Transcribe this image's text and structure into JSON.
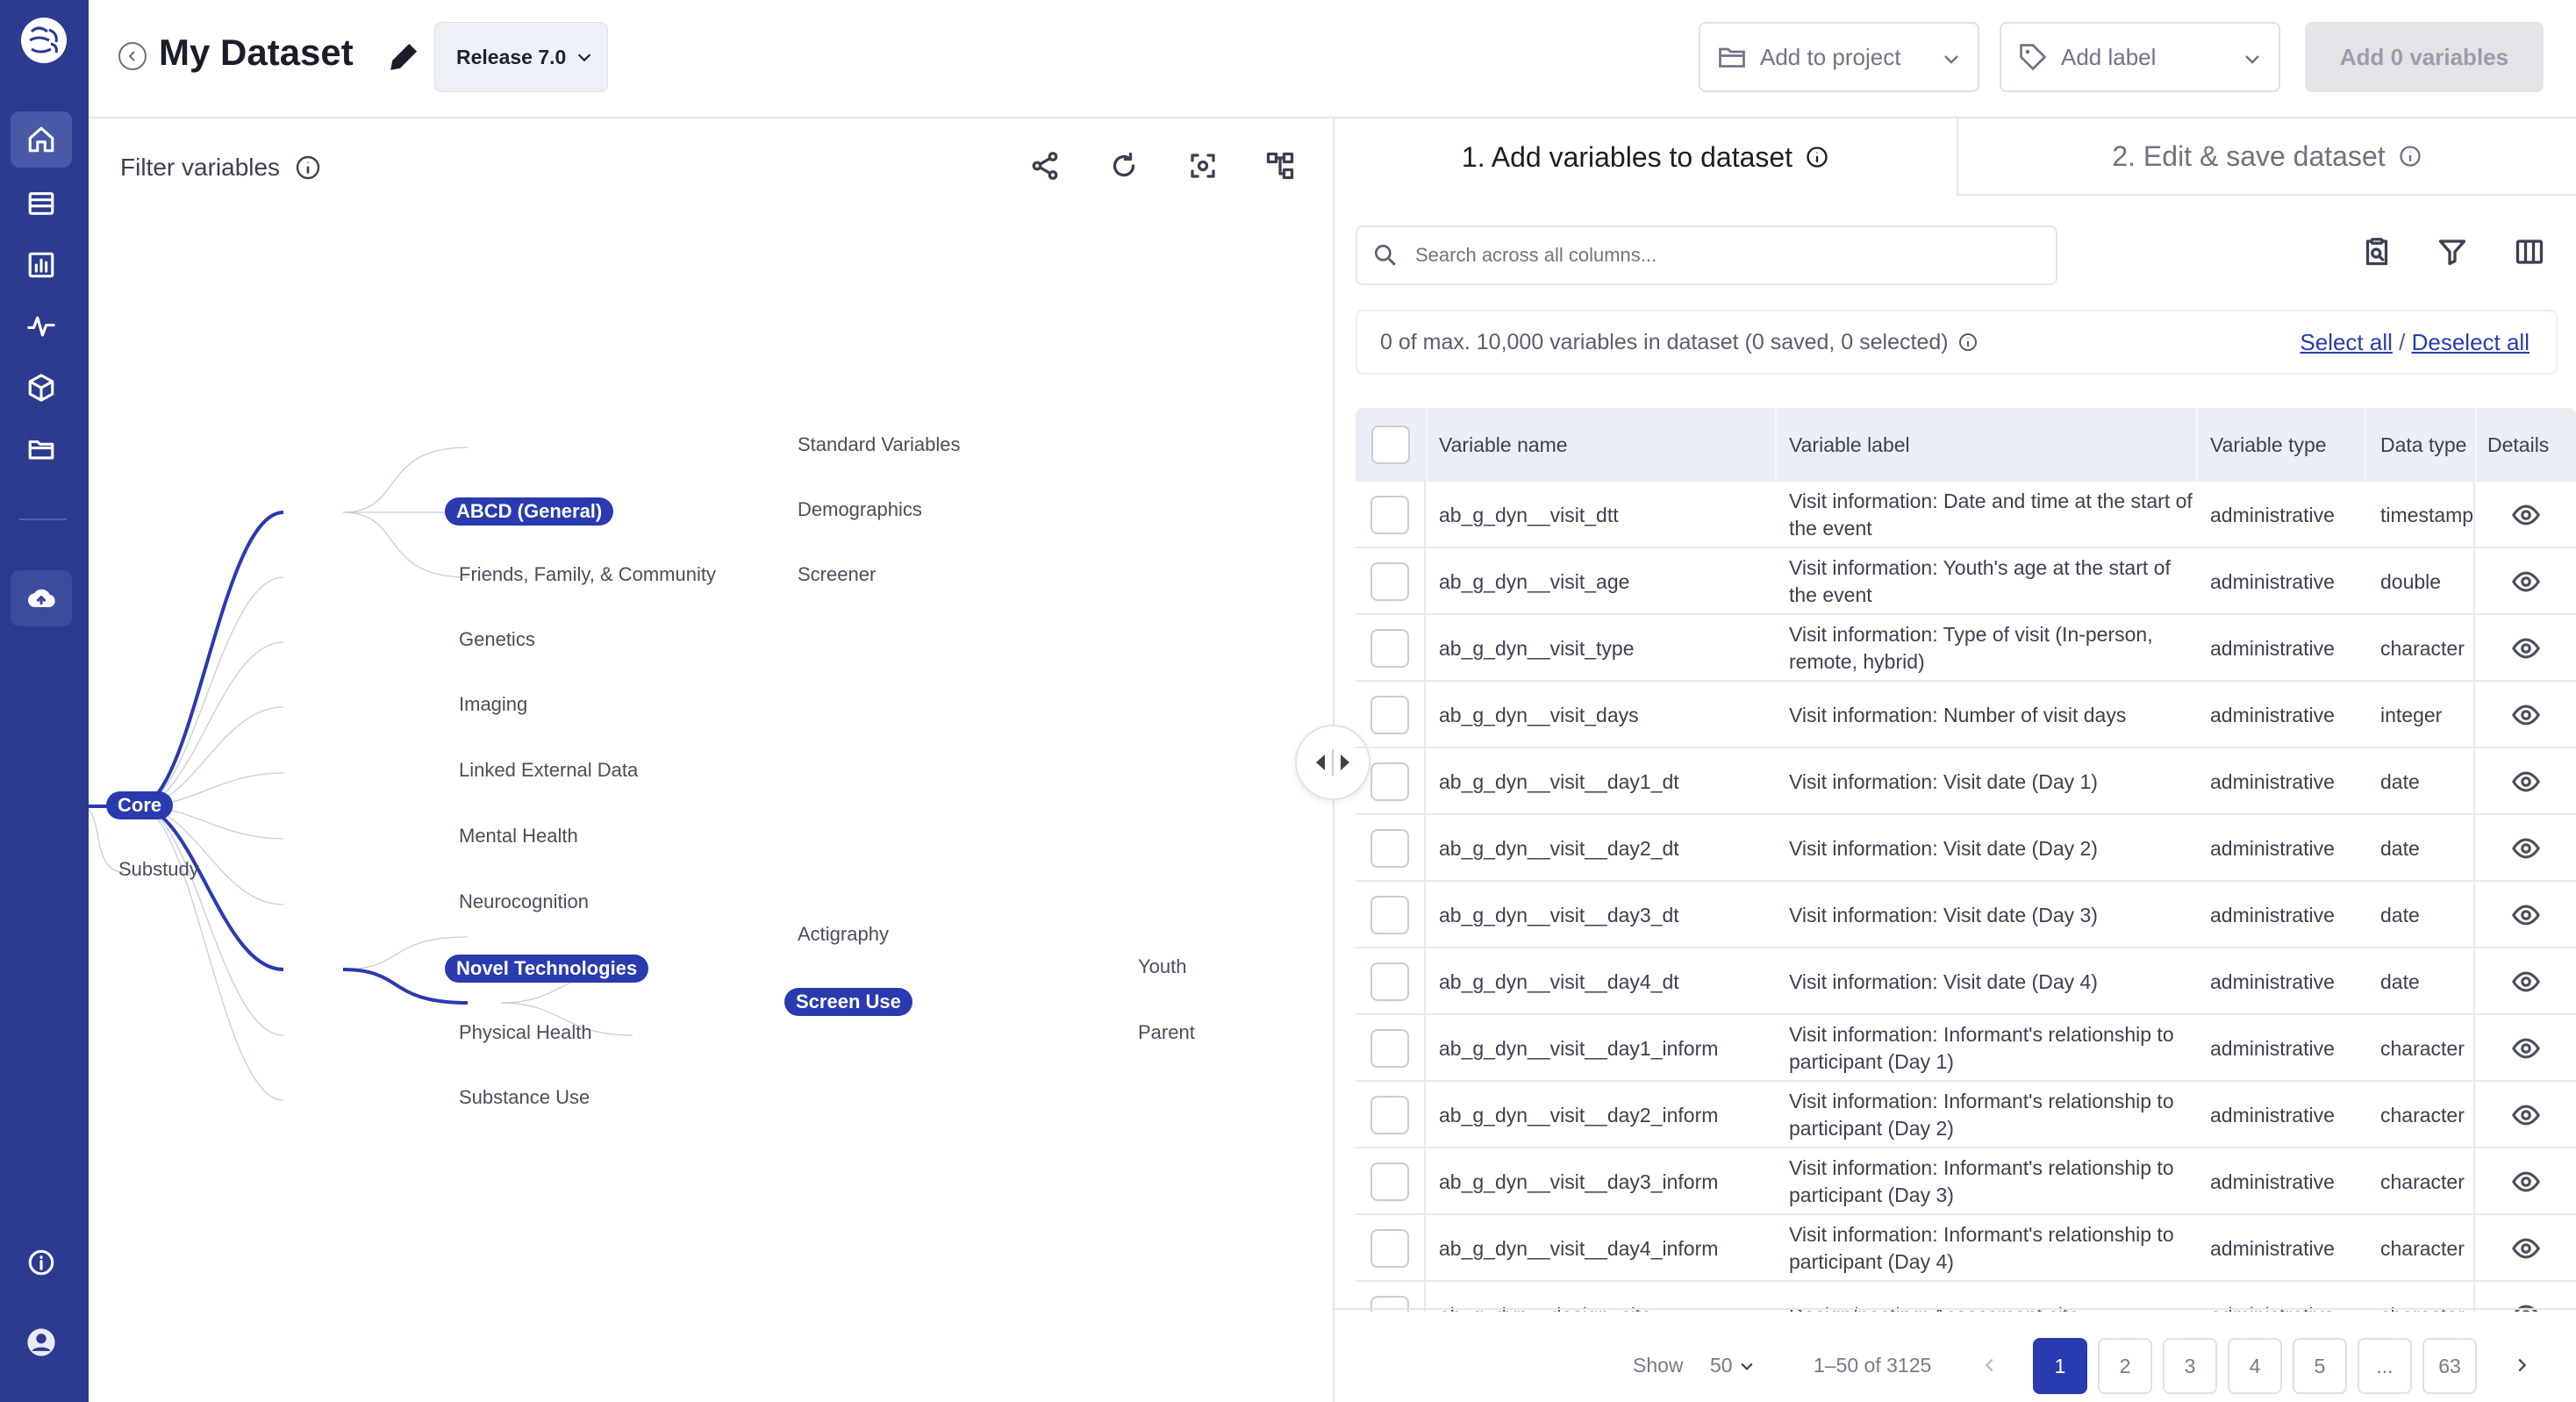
{
  "header": {
    "title": "My Dataset",
    "release": "Release 7.0",
    "add_to_project": "Add to project",
    "add_label": "Add label",
    "add_variables": "Add 0 variables"
  },
  "sidebar": {
    "items": [
      "home-icon",
      "list-icon",
      "chart-icon",
      "activity-icon",
      "cube-icon",
      "folder-icon",
      "cloud-upload-icon",
      "info-icon",
      "user-icon"
    ],
    "accent": "#2c3a8f"
  },
  "filter": {
    "title": "Filter variables"
  },
  "tree": {
    "root": "Core",
    "root_sibling": "Substudy",
    "level1": [
      "ABCD (General)",
      "Friends, Family, & Community",
      "Genetics",
      "Imaging",
      "Linked External Data",
      "Mental Health",
      "Neurocognition",
      "Novel Technologies",
      "Physical Health",
      "Substance Use"
    ],
    "abcd_children": [
      "Standard Variables",
      "Demographics",
      "Screener"
    ],
    "novel_children": [
      "Actigraphy",
      "Screen Use"
    ],
    "screen_children": [
      "Youth",
      "Parent"
    ],
    "selected": [
      "Core",
      "ABCD (General)",
      "Novel Technologies",
      "Screen Use"
    ]
  },
  "tabs": {
    "tab1": "1. Add variables to dataset",
    "tab2": "2. Edit & save dataset"
  },
  "search": {
    "placeholder": "Search across all columns..."
  },
  "count": {
    "text": "0 of max. 10,000 variables in dataset (0 saved, 0 selected)",
    "select_all": "Select all",
    "separator": "/",
    "deselect_all": "Deselect all"
  },
  "table": {
    "columns": [
      "Variable name",
      "Variable label",
      "Variable type",
      "Data type",
      "Details"
    ],
    "rows": [
      {
        "name": "ab_g_dyn__visit_dtt",
        "label": "Visit information: Date and time at the start of the event",
        "type": "administrative",
        "dtype": "timestamp"
      },
      {
        "name": "ab_g_dyn__visit_age",
        "label": "Visit information: Youth's age at the start of the event",
        "type": "administrative",
        "dtype": "double"
      },
      {
        "name": "ab_g_dyn__visit_type",
        "label": "Visit information: Type of visit (In-person, remote, hybrid)",
        "type": "administrative",
        "dtype": "character"
      },
      {
        "name": "ab_g_dyn__visit_days",
        "label": "Visit information: Number of visit days",
        "type": "administrative",
        "dtype": "integer"
      },
      {
        "name": "ab_g_dyn__visit__day1_dt",
        "label": "Visit information: Visit date (Day 1)",
        "type": "administrative",
        "dtype": "date"
      },
      {
        "name": "ab_g_dyn__visit__day2_dt",
        "label": "Visit information: Visit date (Day 2)",
        "type": "administrative",
        "dtype": "date"
      },
      {
        "name": "ab_g_dyn__visit__day3_dt",
        "label": "Visit information: Visit date (Day 3)",
        "type": "administrative",
        "dtype": "date"
      },
      {
        "name": "ab_g_dyn__visit__day4_dt",
        "label": "Visit information: Visit date (Day 4)",
        "type": "administrative",
        "dtype": "date"
      },
      {
        "name": "ab_g_dyn__visit__day1_inform",
        "label": "Visit information: Informant's relationship to participant (Day 1)",
        "type": "administrative",
        "dtype": "character"
      },
      {
        "name": "ab_g_dyn__visit__day2_inform",
        "label": "Visit information: Informant's relationship to participant (Day 2)",
        "type": "administrative",
        "dtype": "character"
      },
      {
        "name": "ab_g_dyn__visit__day3_inform",
        "label": "Visit information: Informant's relationship to participant (Day 3)",
        "type": "administrative",
        "dtype": "character"
      },
      {
        "name": "ab_g_dyn__visit__day4_inform",
        "label": "Visit information: Informant's relationship to participant (Day 4)",
        "type": "administrative",
        "dtype": "character"
      },
      {
        "name": "ab_g_dyn__design_site",
        "label": "Design/nesting: Assessment site",
        "type": "administrative",
        "dtype": "character"
      }
    ]
  },
  "pager": {
    "show_label": "Show",
    "page_size": "50",
    "range": "1–50 of 3125",
    "pages": [
      "1",
      "2",
      "3",
      "4",
      "5",
      "...",
      "63"
    ]
  }
}
